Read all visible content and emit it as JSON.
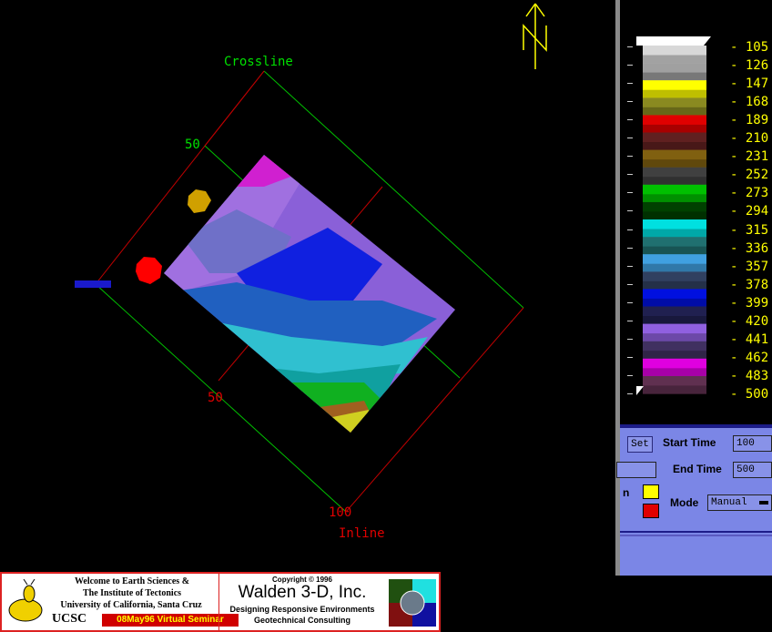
{
  "viewport": {
    "crossline_label": "Crossline",
    "inline_label": "Inline",
    "tick_labels": {
      "crossline_50": "50",
      "inline_50": "50",
      "inline_100": "100"
    },
    "north_label": "N"
  },
  "colorbar": {
    "values": [
      "105",
      "126",
      "147",
      "168",
      "189",
      "210",
      "231",
      "252",
      "273",
      "294",
      "315",
      "336",
      "357",
      "378",
      "399",
      "420",
      "441",
      "462",
      "483",
      "500"
    ],
    "colors": [
      "#d8d8d8",
      "#a0a0a0",
      "#ffff00",
      "#8a8a20",
      "#e00000",
      "#602020",
      "#806010",
      "#404040",
      "#00c000",
      "#004000",
      "#00e0e0",
      "#207070",
      "#40a0e0",
      "#304060",
      "#0010e0",
      "#202050",
      "#9060e0",
      "#403060",
      "#e000e0",
      "#603050"
    ]
  },
  "controls": {
    "set_button": "Set",
    "start_time_label": "Start Time",
    "start_time_value": "100",
    "end_time_label": "End Time",
    "end_time_value": "500",
    "mode_label": "Mode",
    "mode_value": "Manual",
    "partial_label": "n"
  },
  "banner": {
    "line1": "Welcome to Earth Sciences &",
    "line2": "The Institute of Tectonics",
    "line3": "University of California, Santa Cruz",
    "ucsc": "UCSC",
    "seminar": "08May96 Virtual Seminar",
    "copyright": "Copyright © 1996",
    "company": "Walden 3-D, Inc.",
    "tagline1": "Designing Responsive Environments",
    "tagline2": "Geotechnical Consulting"
  }
}
